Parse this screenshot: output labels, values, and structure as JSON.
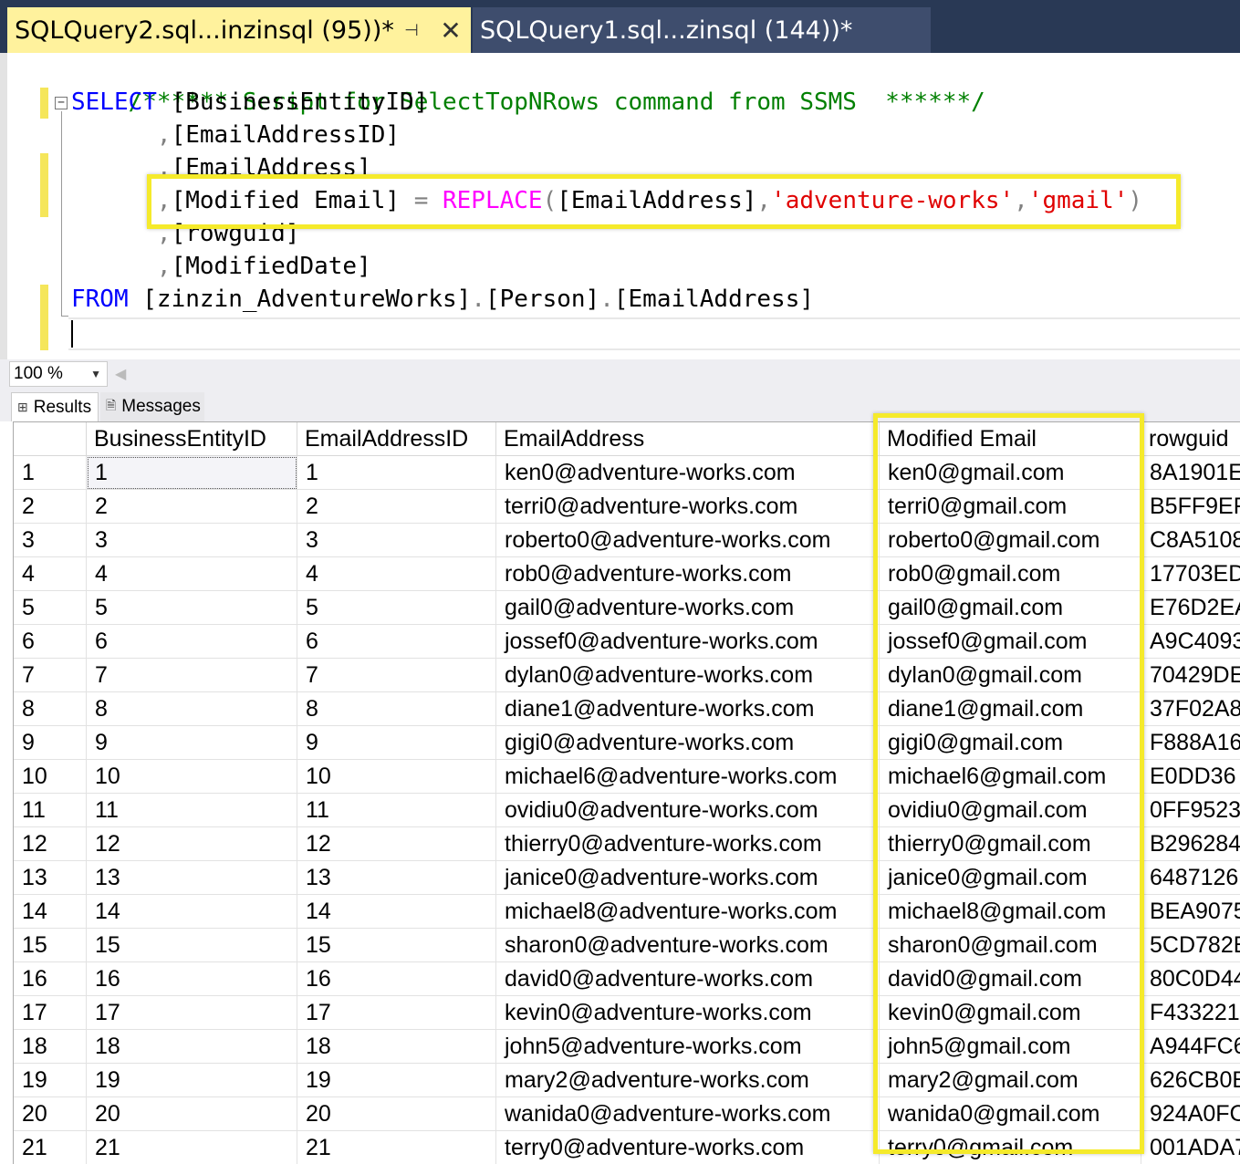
{
  "tabs": {
    "active": {
      "label": "SQLQuery2.sql...inzinsql (95))*",
      "pin_icon": "pin-icon",
      "close_icon": "close-icon"
    },
    "inactive": {
      "label": "SQLQuery1.sql...zinsql (144))*"
    }
  },
  "editor": {
    "comment": "/****** Script for SelectTopNRows command from SSMS  ******/",
    "select_kw": "SELECT",
    "col1": "[BusinessEntityID]",
    "col2": "[EmailAddressID]",
    "col3": "[EmailAddress]",
    "col4_name": "[Modified Email]",
    "col4_eq": "=",
    "col4_fn": "REPLACE",
    "col4_arg": "[EmailAddress]",
    "col4_from": "'adventure-works'",
    "col4_to": "'gmail'",
    "col5": "[rowguid]",
    "col6": "[ModifiedDate]",
    "from_kw": "FROM",
    "from_db": "[zinzin_AdventureWorks]",
    "from_schema": "[Person]",
    "from_table": "[EmailAddress]",
    "comma": ",",
    "lparen": "(",
    "rparen": ")",
    "dot": ".",
    "collapse_glyph": "−"
  },
  "zoom": {
    "value": "100 %"
  },
  "result_tabs": {
    "results": "Results",
    "messages": "Messages"
  },
  "grid": {
    "columns": [
      "",
      "BusinessEntityID",
      "EmailAddressID",
      "EmailAddress",
      "Modified Email",
      "rowguid"
    ],
    "rows": [
      [
        "1",
        "1",
        "1",
        "ken0@adventure-works.com",
        "ken0@gmail.com",
        "8A1901E"
      ],
      [
        "2",
        "2",
        "2",
        "terri0@adventure-works.com",
        "terri0@gmail.com",
        "B5FF9EF"
      ],
      [
        "3",
        "3",
        "3",
        "roberto0@adventure-works.com",
        "roberto0@gmail.com",
        "C8A5108"
      ],
      [
        "4",
        "4",
        "4",
        "rob0@adventure-works.com",
        "rob0@gmail.com",
        "17703ED"
      ],
      [
        "5",
        "5",
        "5",
        "gail0@adventure-works.com",
        "gail0@gmail.com",
        "E76D2EA"
      ],
      [
        "6",
        "6",
        "6",
        "jossef0@adventure-works.com",
        "jossef0@gmail.com",
        "A9C4093"
      ],
      [
        "7",
        "7",
        "7",
        "dylan0@adventure-works.com",
        "dylan0@gmail.com",
        "70429DE"
      ],
      [
        "8",
        "8",
        "8",
        "diane1@adventure-works.com",
        "diane1@gmail.com",
        "37F02A8"
      ],
      [
        "9",
        "9",
        "9",
        "gigi0@adventure-works.com",
        "gigi0@gmail.com",
        "F888A16"
      ],
      [
        "10",
        "10",
        "10",
        "michael6@adventure-works.com",
        "michael6@gmail.com",
        "E0DD36"
      ],
      [
        "11",
        "11",
        "11",
        "ovidiu0@adventure-works.com",
        "ovidiu0@gmail.com",
        "0FF9523"
      ],
      [
        "12",
        "12",
        "12",
        "thierry0@adventure-works.com",
        "thierry0@gmail.com",
        "B296284"
      ],
      [
        "13",
        "13",
        "13",
        "janice0@adventure-works.com",
        "janice0@gmail.com",
        "6487126"
      ],
      [
        "14",
        "14",
        "14",
        "michael8@adventure-works.com",
        "michael8@gmail.com",
        "BEA9075"
      ],
      [
        "15",
        "15",
        "15",
        "sharon0@adventure-works.com",
        "sharon0@gmail.com",
        "5CD782E"
      ],
      [
        "16",
        "16",
        "16",
        "david0@adventure-works.com",
        "david0@gmail.com",
        "80C0D44"
      ],
      [
        "17",
        "17",
        "17",
        "kevin0@adventure-works.com",
        "kevin0@gmail.com",
        "F433221"
      ],
      [
        "18",
        "18",
        "18",
        "john5@adventure-works.com",
        "john5@gmail.com",
        "A944FC6"
      ],
      [
        "19",
        "19",
        "19",
        "mary2@adventure-works.com",
        "mary2@gmail.com",
        "626CB0E"
      ],
      [
        "20",
        "20",
        "20",
        "wanida0@adventure-works.com",
        "wanida0@gmail.com",
        "924A0FC"
      ],
      [
        "21",
        "21",
        "21",
        "terry0@adventure-works.com",
        "terry0@gmail.com",
        "001ADA7"
      ]
    ]
  },
  "colors": {
    "keyword": "#0000ff",
    "comment": "#008000",
    "function": "#ff00ff",
    "string": "#e00000",
    "highlight": "#f5ea2b",
    "active_tab": "#fff29d",
    "tabbar": "#293955"
  }
}
